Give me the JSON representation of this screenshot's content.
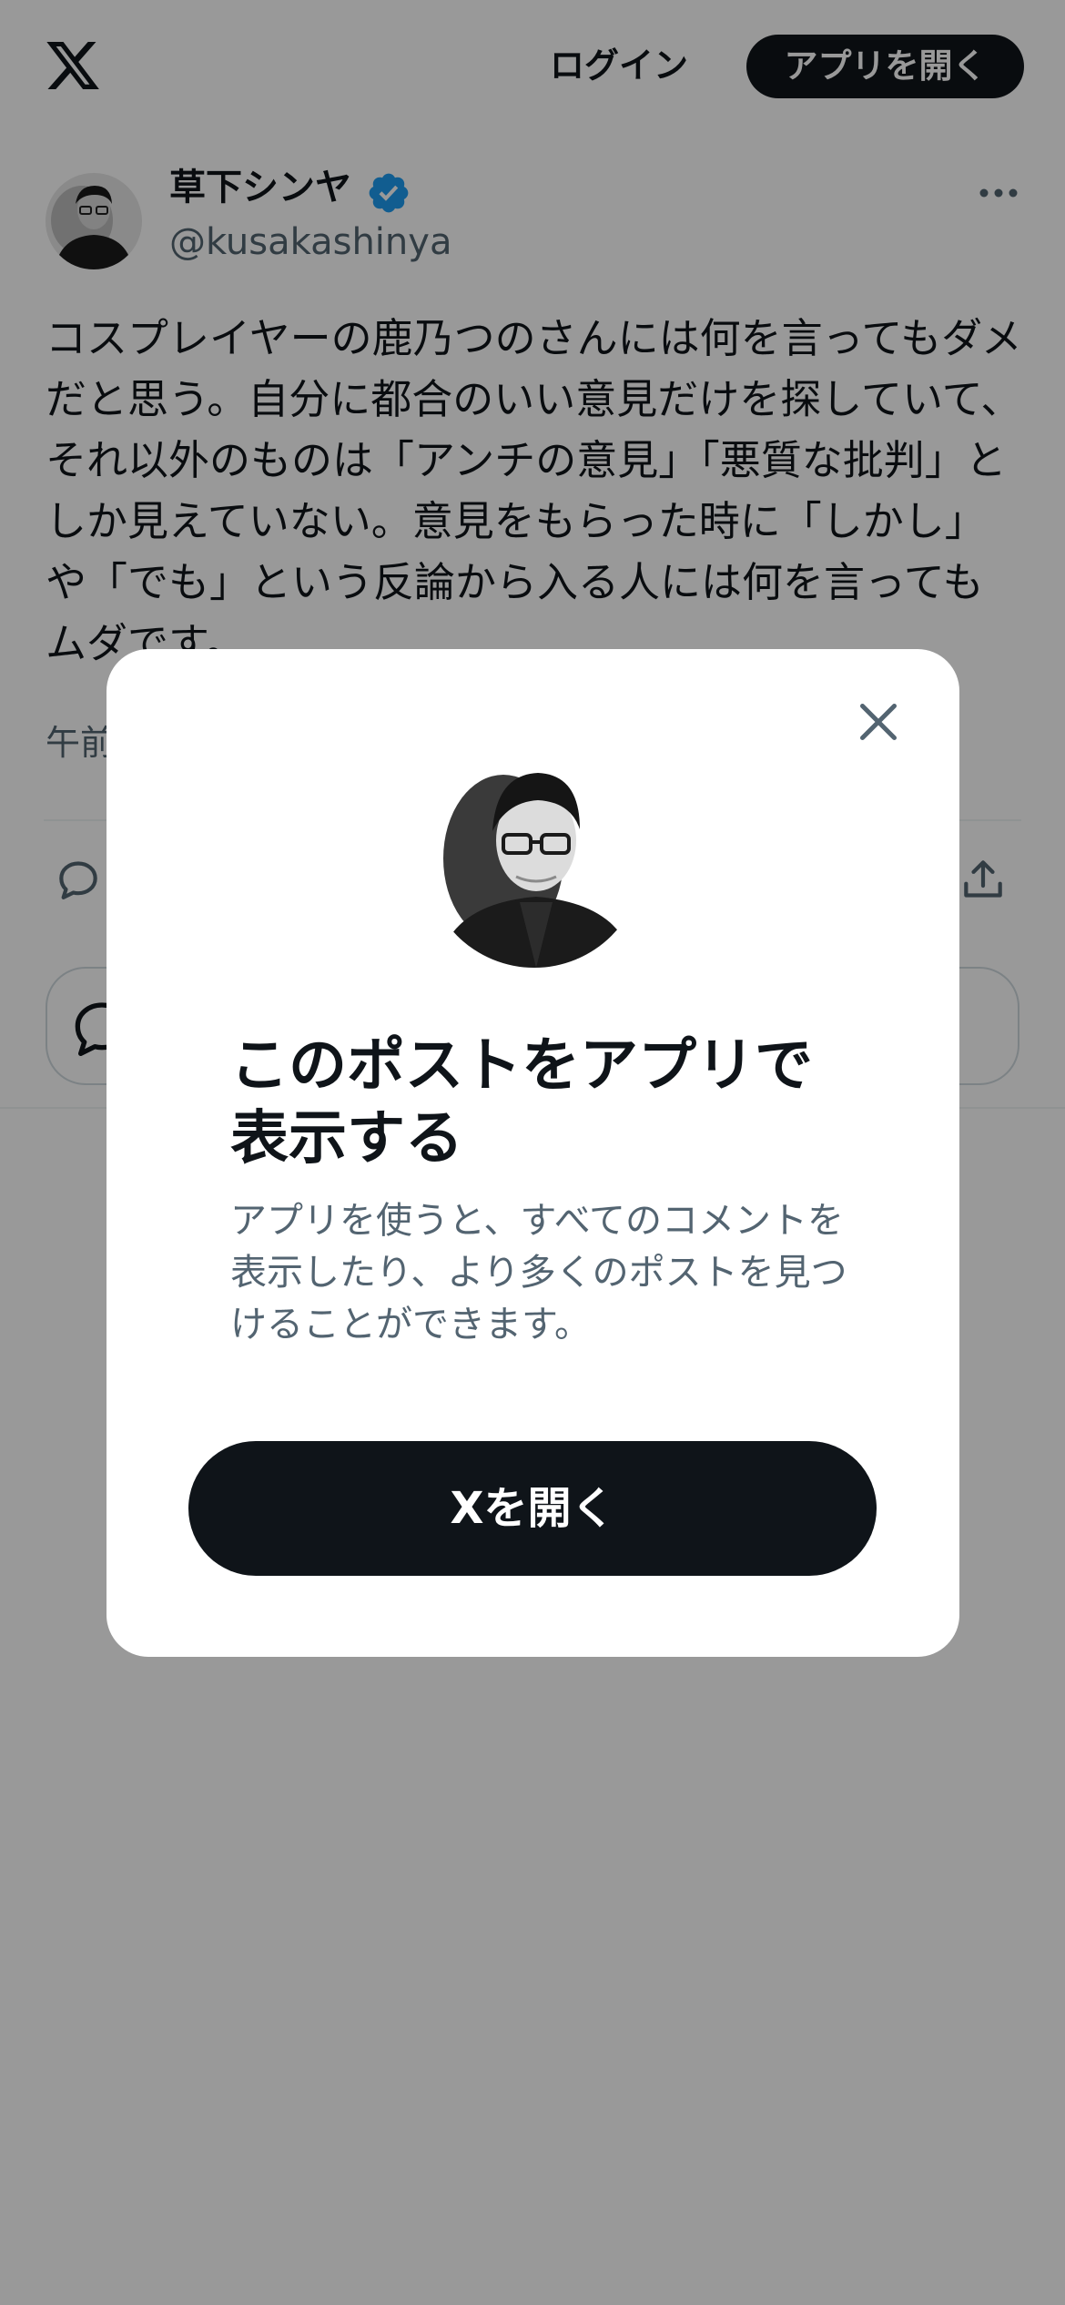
{
  "topbar": {
    "logo_icon": "x-logo-icon",
    "login_label": "ログイン",
    "open_app_label": "アプリを開く"
  },
  "post": {
    "author_name": "草下シンヤ",
    "verified": true,
    "verified_color": "#1d9bf0",
    "author_handle": "@kusakashinya",
    "text": "コスプレイヤーの鹿乃つのさんには何を言ってもダメだと思う。自分に都合のいい意見だけを探していて、それ以外のものは「アンチの意見」「悪質な批判」としか見えていない。意見をもらった時に「しかし」や「でも」という反論から入る人には何を言ってもムダです。",
    "timestamp_partial": "午前",
    "actions": [
      "reply-icon",
      "share-icon"
    ],
    "reply_box_icon": "comment-icon"
  },
  "modal": {
    "title": "このポストをアプリで表示する",
    "description": "アプリを使うと、すべてのコメントを表示したり、より多くのポストを見つけることができます。",
    "open_button_label": "Xを開く",
    "close_icon": "close-icon"
  },
  "colors": {
    "primary_text": "#0f1419",
    "secondary_text": "#536471",
    "button_bg": "#0f1419",
    "overlay": "rgba(0,0,0,0.40)"
  }
}
